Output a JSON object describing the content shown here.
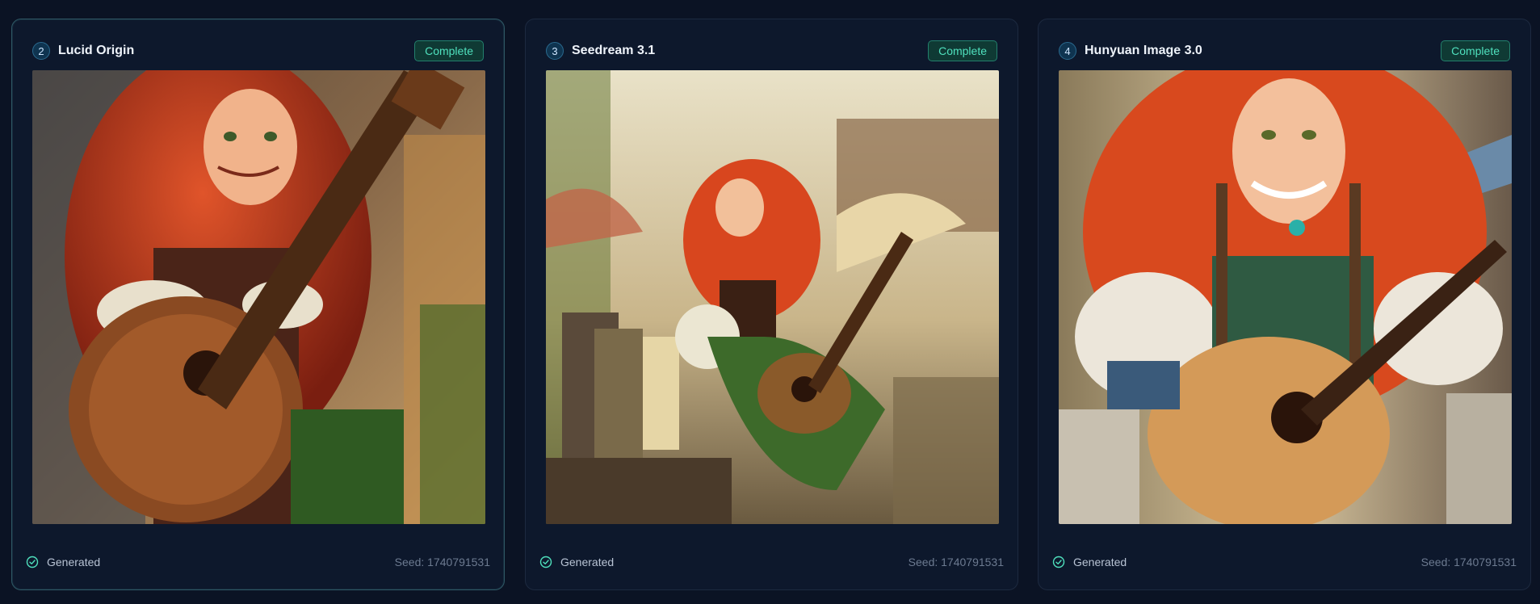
{
  "cards": [
    {
      "number": "2",
      "model": "Lucid Origin",
      "status": "Complete",
      "image": "elf bard with red curly hair holding an ornate lute in a sunlit market street",
      "footer": {
        "status_text": "Generated",
        "seed": "Seed: 1740791531"
      }
    },
    {
      "number": "3",
      "model": "Seedream 3.1",
      "status": "Complete",
      "image": "cheerful red-haired elf playing a mandolin in a busy village market",
      "footer": {
        "status_text": "Generated",
        "seed": "Seed: 1740791531"
      }
    },
    {
      "number": "4",
      "model": "Hunyuan Image 3.0",
      "status": "Complete",
      "image": "smiling freckled elf with red hair strumming an acoustic guitar on a cobbled street",
      "footer": {
        "status_text": "Generated",
        "seed": "Seed: 1740791531"
      }
    }
  ],
  "colors": {
    "page_bg": "#0b1324",
    "card_bg": "#0d182c",
    "accent_teal": "#4fe0bd",
    "badge_blue": "#0f3450"
  }
}
